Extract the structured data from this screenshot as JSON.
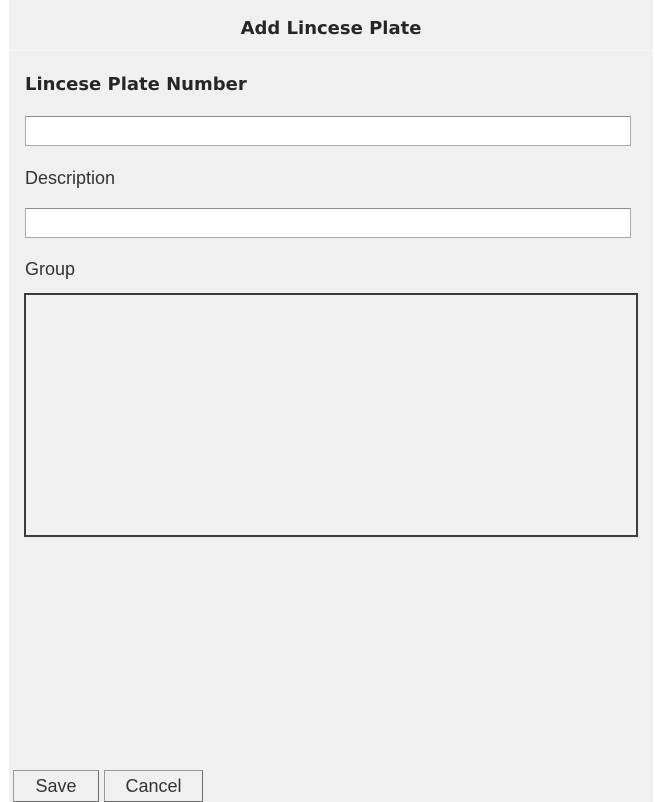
{
  "dialog": {
    "title": "Add Lincese Plate"
  },
  "form": {
    "plate_label": "Lincese Plate Number",
    "plate_value": "",
    "description_label": "Description",
    "description_value": "",
    "group_label": "Group",
    "group_items": []
  },
  "buttons": {
    "save_label": "Save",
    "cancel_label": "Cancel"
  },
  "colors": {
    "background": "#f0f0f0",
    "input_background": "#ffffff",
    "group_border": "#3c3c3c"
  }
}
